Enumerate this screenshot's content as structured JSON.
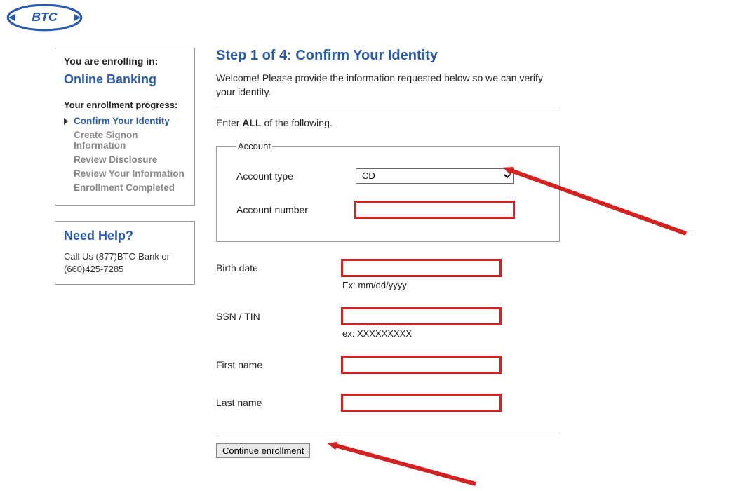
{
  "logo_text": "BTC",
  "sidebar": {
    "enrolling_label": "You are enrolling in:",
    "enrolling_title": "Online Banking",
    "progress_label": "Your enrollment progress:",
    "steps": [
      "Confirm Your Identity",
      "Create Signon Information",
      "Review Disclosure",
      "Review Your Information",
      "Enrollment Completed"
    ],
    "help_heading": "Need Help?",
    "help_text": "Call Us  (877)BTC-Bank or (660)425-7285"
  },
  "main": {
    "step_title": "Step 1 of 4: Confirm Your Identity",
    "welcome": "Welcome! Please provide the information requested below so we can verify your identity.",
    "enter_prefix": "Enter ",
    "enter_all": "ALL",
    "enter_suffix": " of the following.",
    "account_legend": "Account",
    "labels": {
      "account_type": "Account type",
      "account_number": "Account number",
      "birth_date": "Birth date",
      "ssn_tin": "SSN / TIN",
      "first_name": "First name",
      "last_name": "Last name"
    },
    "account_type_value": "CD",
    "account_type_options": [
      "CD"
    ],
    "account_number_value": "",
    "birth_date_value": "",
    "birth_date_hint": "Ex: mm/dd/yyyy",
    "ssn_value": "",
    "ssn_hint": "ex: XXXXXXXXX",
    "first_name_value": "",
    "last_name_value": "",
    "continue_label": "Continue enrollment"
  }
}
